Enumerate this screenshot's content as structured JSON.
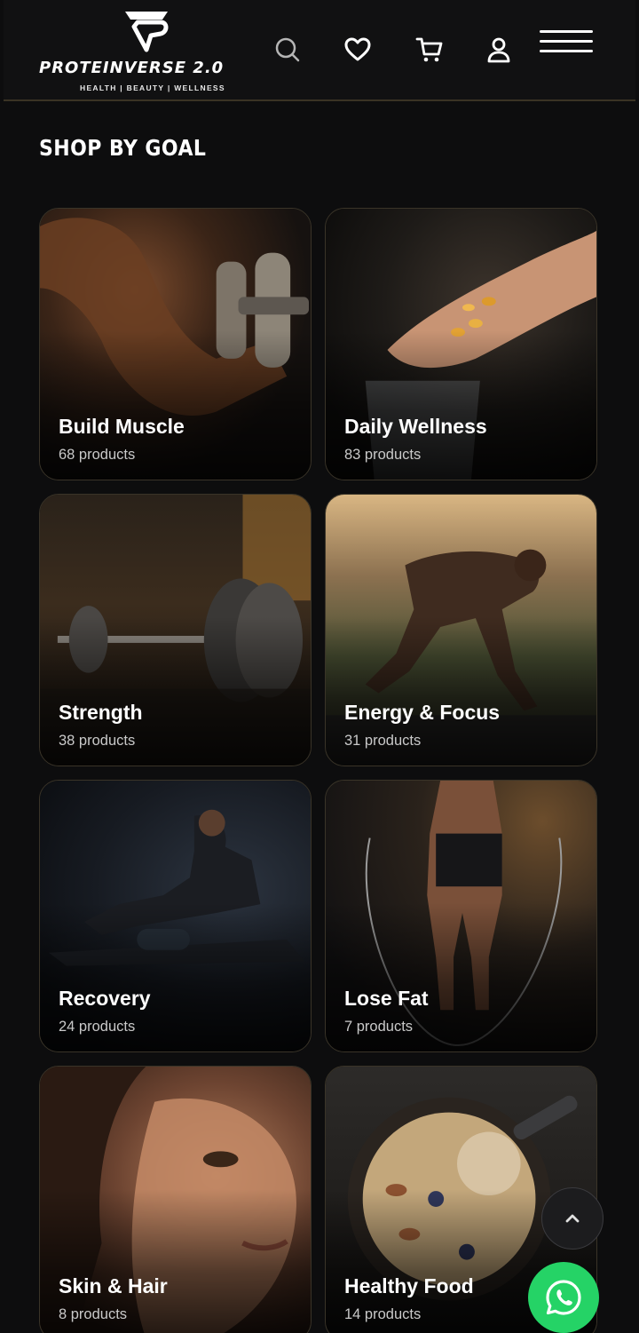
{
  "brand": {
    "name": "PROTEINVERSE 2.0",
    "tagline": "HEALTH | BEAUTY | WELLNESS"
  },
  "header_icons": [
    "search-icon",
    "heart-icon",
    "cart-icon",
    "user-icon",
    "menu-icon"
  ],
  "section": {
    "title": "SHOP BY GOAL"
  },
  "goals": [
    {
      "title": "Build Muscle",
      "count": "68 products",
      "image": "dumbbell-curl"
    },
    {
      "title": "Daily Wellness",
      "count": "83 products",
      "image": "capsules-hand"
    },
    {
      "title": "Strength",
      "count": "38 products",
      "image": "barbell"
    },
    {
      "title": "Energy & Focus",
      "count": "31 products",
      "image": "sprinter"
    },
    {
      "title": "Recovery",
      "count": "24 products",
      "image": "foam-roller"
    },
    {
      "title": "Lose Fat",
      "count": "7 products",
      "image": "jump-rope"
    },
    {
      "title": "Skin & Hair",
      "count": "8 products",
      "image": "face-portrait"
    },
    {
      "title": "Healthy Food",
      "count": "14 products",
      "image": "oat-bowl"
    }
  ],
  "colors": {
    "accent_green": "#25d366",
    "card_border": "#3a3428",
    "background": "#0d0d0e"
  }
}
